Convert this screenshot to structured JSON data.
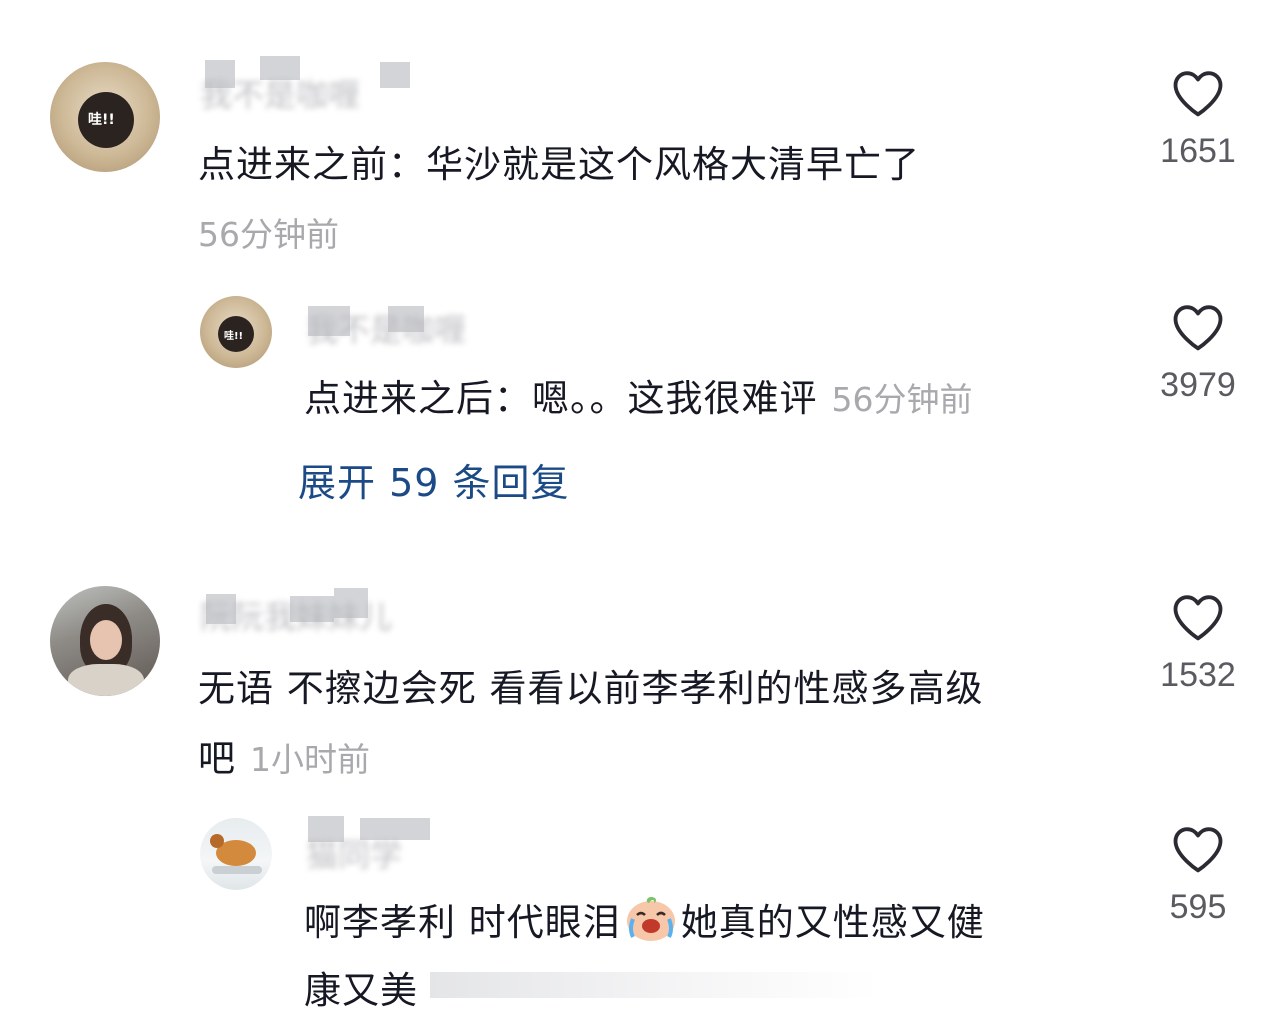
{
  "comments": [
    {
      "username": "我不是咖喱",
      "text": "点进来之前：华沙就是这个风格大清早亡了",
      "time": "56分钟前",
      "likes": "1651",
      "avatar_caption": "哇!!"
    },
    {
      "username": "我不是咖喱",
      "text": "点进来之后：嗯。。这我很难评",
      "time": "56分钟前",
      "likes": "3979",
      "avatar_caption": "哇!!",
      "expand_label": "展开 59 条回复"
    },
    {
      "username": "阮阮我妹妹儿",
      "text_line1": "无语 不擦边会死 看看以前李孝利的性感多高级",
      "text_line2": "吧",
      "time": "1小时前",
      "likes": "1532"
    },
    {
      "username": "猫同学",
      "text_line1a": "啊李孝利 时代眼泪",
      "text_line1b": "她真的又性感又健",
      "text_line2": "康又美",
      "likes": "595",
      "emoji": "crying-emoji"
    }
  ],
  "colors": {
    "text": "#161823",
    "secondary": "#a8a9ad",
    "link": "#1b4a86",
    "like_count": "#5a5b61"
  },
  "icons": [
    "heart-icon"
  ]
}
